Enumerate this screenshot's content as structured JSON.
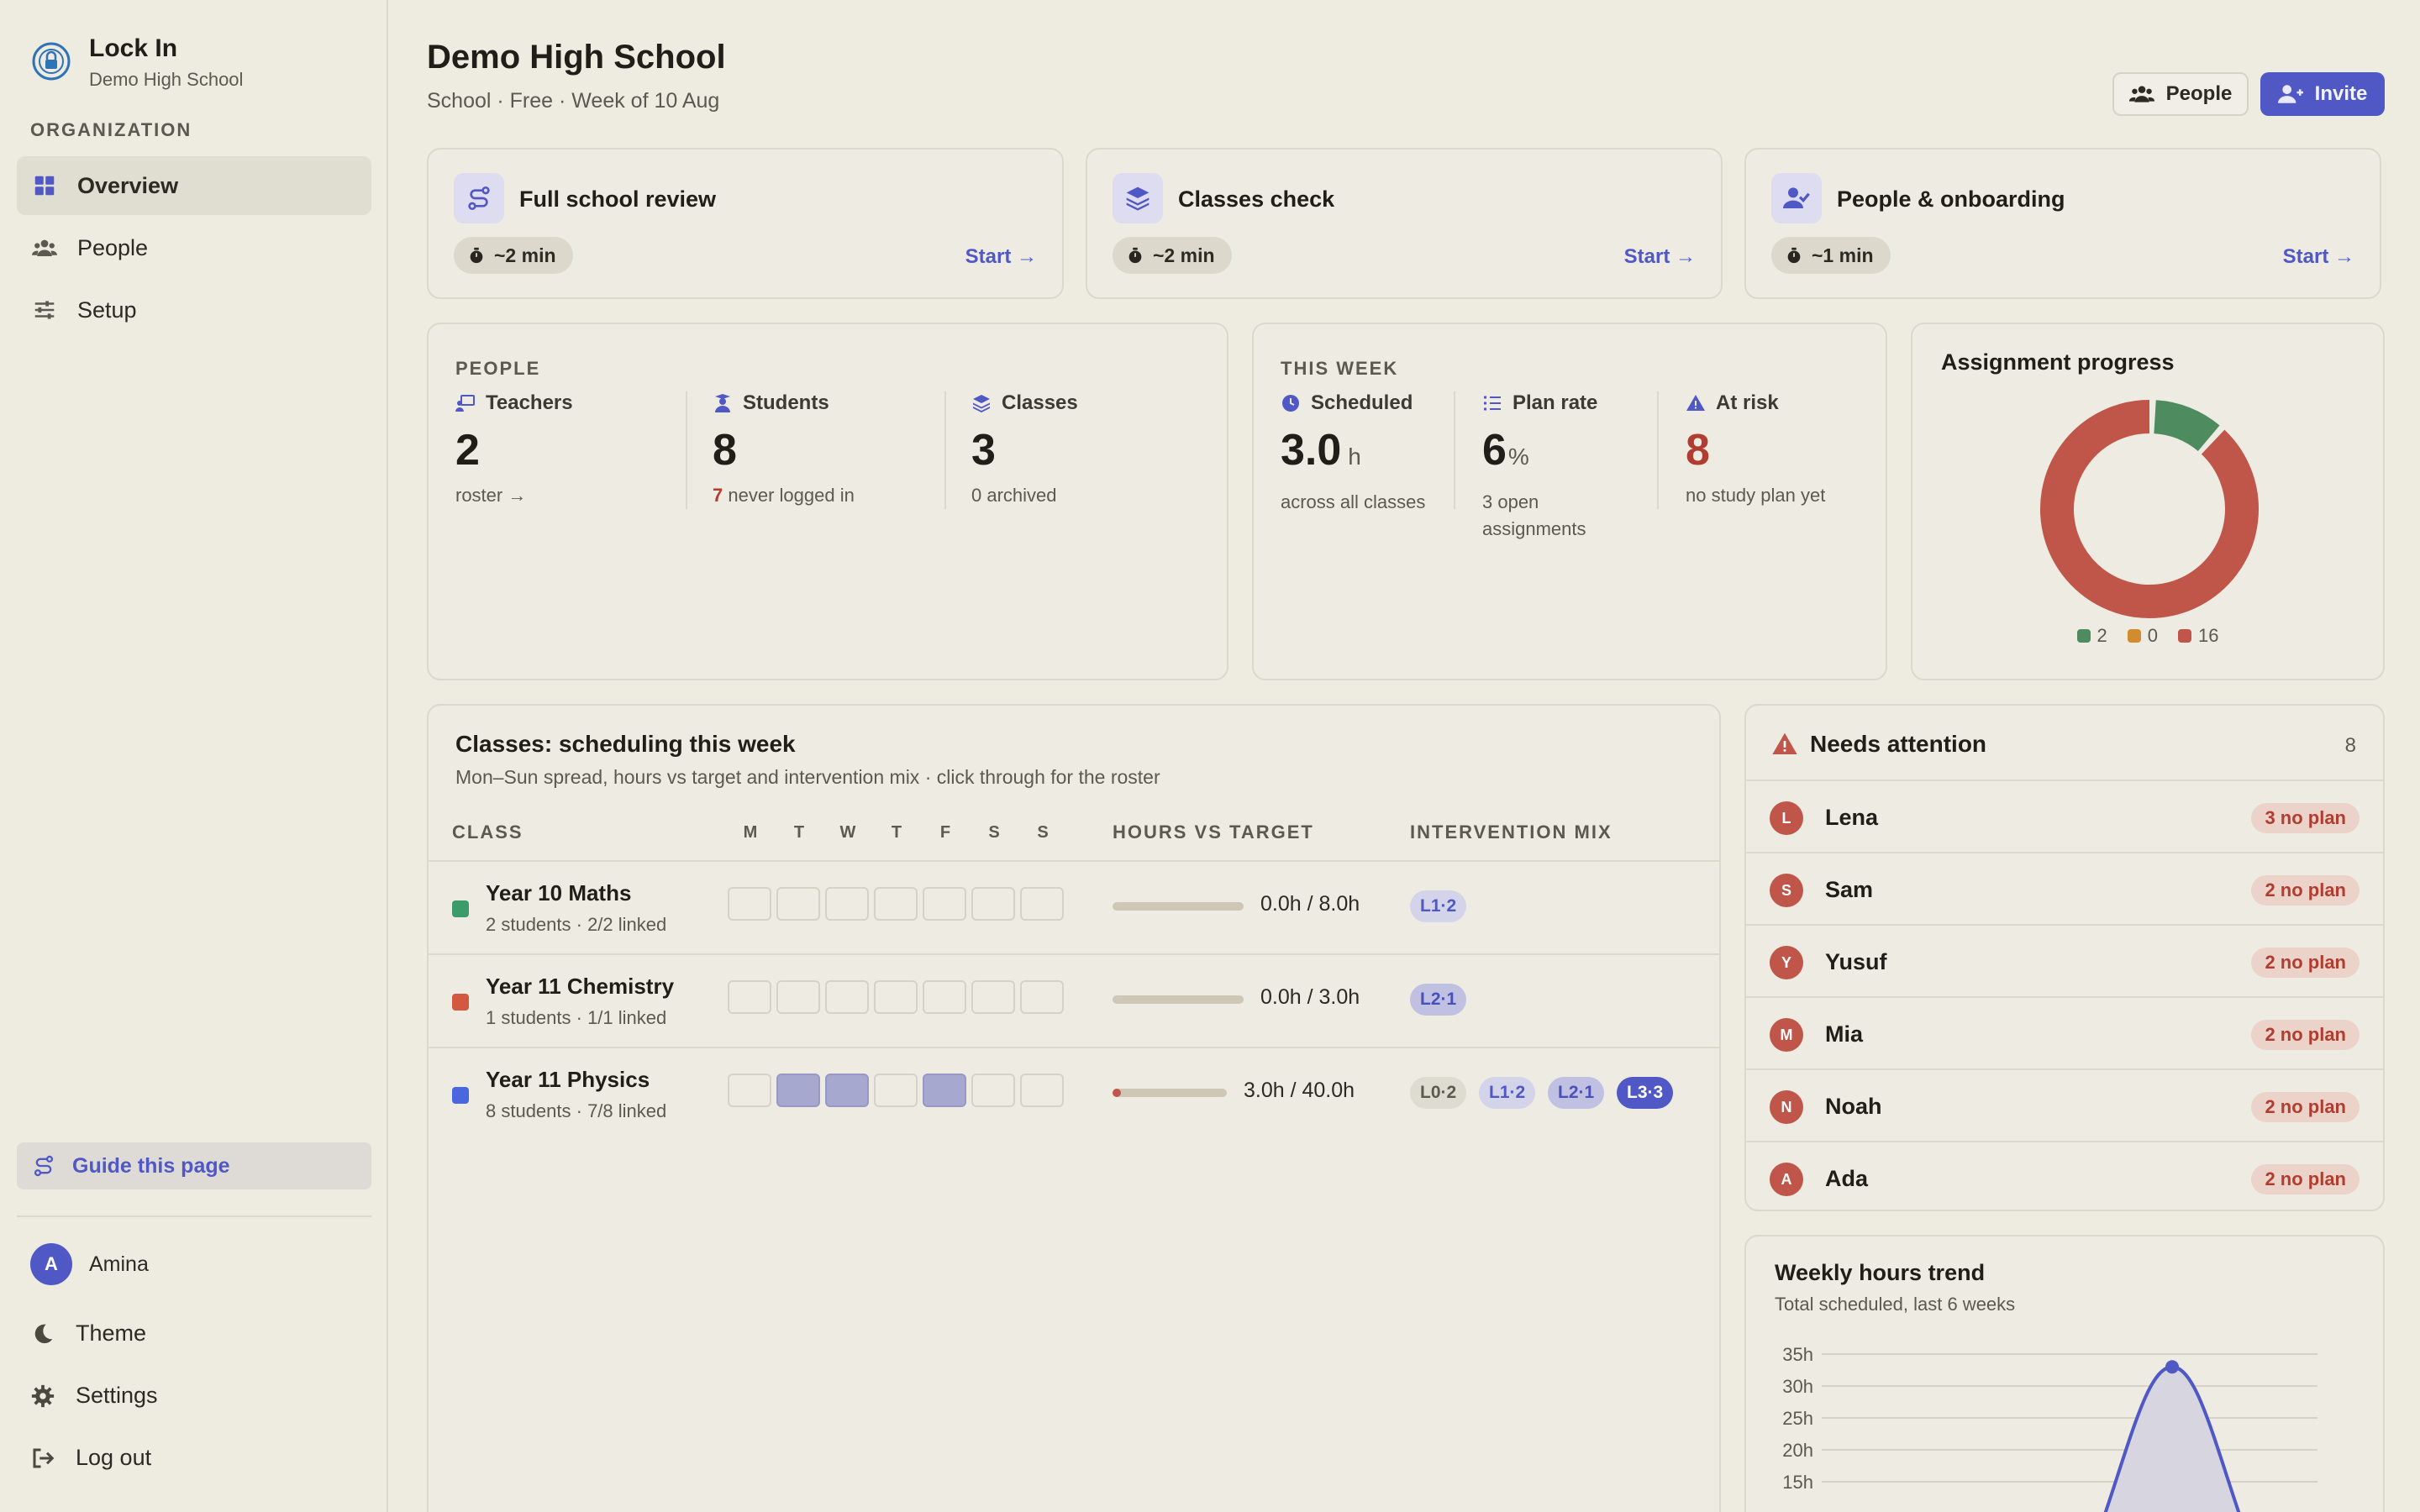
{
  "sidebar": {
    "brand_name": "Lock In",
    "brand_sub": "Demo High School",
    "section_label": "ORGANIZATION",
    "nav": [
      {
        "label": "Overview",
        "icon": "grid-icon",
        "active": true
      },
      {
        "label": "People",
        "icon": "users-icon",
        "active": false
      },
      {
        "label": "Setup",
        "icon": "sliders-icon",
        "active": false
      }
    ],
    "guide_label": "Guide this page",
    "user_initial": "A",
    "user_name": "Amina",
    "theme_label": "Theme",
    "settings_label": "Settings",
    "logout_label": "Log out"
  },
  "header": {
    "title": "Demo High School",
    "subtitle": "School · Free · Week of 10 Aug",
    "people_button": "People",
    "invite_button": "Invite"
  },
  "quick_cards": [
    {
      "title": "Full school review",
      "time": "~2 min",
      "start": "Start →",
      "icon": "route-icon"
    },
    {
      "title": "Classes check",
      "time": "~2 min",
      "start": "Start →",
      "icon": "layers-icon"
    },
    {
      "title": "People & onboarding",
      "time": "~1 min",
      "start": "Start →",
      "icon": "user-check-icon"
    }
  ],
  "people_card": {
    "label": "PEOPLE",
    "teachers_label": "Teachers",
    "teachers_value": "2",
    "teachers_note": "roster →",
    "students_label": "Students",
    "students_value": "8",
    "students_note_num": "7",
    "students_note": "never logged in",
    "classes_label": "Classes",
    "classes_value": "3",
    "classes_note": "0 archived"
  },
  "week_card": {
    "label": "THIS WEEK",
    "scheduled_label": "Scheduled",
    "scheduled_value": "3.0",
    "scheduled_unit": "h",
    "scheduled_note": "across all classes",
    "plan_label": "Plan rate",
    "plan_value": "6",
    "plan_unit": "%",
    "plan_note": "3 open assignments",
    "risk_label": "At risk",
    "risk_value": "8",
    "risk_note": "no study plan yet"
  },
  "assignment_progress": {
    "title": "Assignment progress",
    "legend": [
      {
        "value": "2",
        "color": "#4e8c5f"
      },
      {
        "value": "0",
        "color": "#d08c2e"
      },
      {
        "value": "16",
        "color": "#c05649"
      }
    ],
    "segments": [
      2,
      0,
      16
    ]
  },
  "classes": {
    "title": "Classes: scheduling this week",
    "subtitle": "Mon–Sun spread, hours vs target and intervention mix · click through for the roster",
    "col_class": "CLASS",
    "col_hours": "HOURS VS TARGET",
    "col_mix": "INTERVENTION MIX",
    "days": [
      "M",
      "T",
      "W",
      "T",
      "F",
      "S",
      "S"
    ],
    "rows": [
      {
        "name": "Year 10 Maths",
        "meta": "2 students · 2/2 linked",
        "color": "#3b9b6a",
        "days": [
          0,
          0,
          0,
          0,
          0,
          0,
          0
        ],
        "hours": "0.0h / 8.0h",
        "progress": 0,
        "chips": [
          {
            "label": "L1·2",
            "level": "l1"
          }
        ]
      },
      {
        "name": "Year 11 Chemistry",
        "meta": "1 students · 1/1 linked",
        "color": "#d4573f",
        "days": [
          0,
          0,
          0,
          0,
          0,
          0,
          0
        ],
        "hours": "0.0h / 3.0h",
        "progress": 0,
        "chips": [
          {
            "label": "L2·1",
            "level": "l2"
          }
        ]
      },
      {
        "name": "Year 11 Physics",
        "meta": "8 students · 7/8 linked",
        "color": "#4b67e0",
        "days": [
          0,
          1,
          1,
          0,
          1,
          0,
          0
        ],
        "hours": "3.0h / 40.0h",
        "progress": 0.075,
        "chips": [
          {
            "label": "L0·2",
            "level": "l0"
          },
          {
            "label": "L1·2",
            "level": "l1"
          },
          {
            "label": "L2·1",
            "level": "l2"
          },
          {
            "label": "L3·3",
            "level": "l3"
          }
        ]
      }
    ]
  },
  "needs_attention": {
    "title": "Needs attention",
    "count": "8",
    "items": [
      {
        "initial": "L",
        "name": "Lena",
        "badge": "3 no plan"
      },
      {
        "initial": "S",
        "name": "Sam",
        "badge": "2 no plan"
      },
      {
        "initial": "Y",
        "name": "Yusuf",
        "badge": "2 no plan"
      },
      {
        "initial": "M",
        "name": "Mia",
        "badge": "2 no plan"
      },
      {
        "initial": "N",
        "name": "Noah",
        "badge": "2 no plan"
      },
      {
        "initial": "A",
        "name": "Ada",
        "badge": "2 no plan"
      }
    ]
  },
  "weekly_trend": {
    "title": "Weekly hours trend",
    "subtitle": "Total scheduled, last 6 weeks"
  },
  "chart_data": {
    "type": "area",
    "title": "Weekly hours trend",
    "subtitle": "Total scheduled, last 6 weeks",
    "y_ticks": [
      "35h",
      "30h",
      "25h",
      "20h",
      "15h"
    ],
    "ylim": [
      10,
      35
    ],
    "x": [
      1,
      2,
      3,
      4,
      5,
      6
    ],
    "series": [
      {
        "values": [
          0,
          0,
          0,
          0,
          33,
          0
        ]
      }
    ],
    "color": "#5058c6"
  }
}
